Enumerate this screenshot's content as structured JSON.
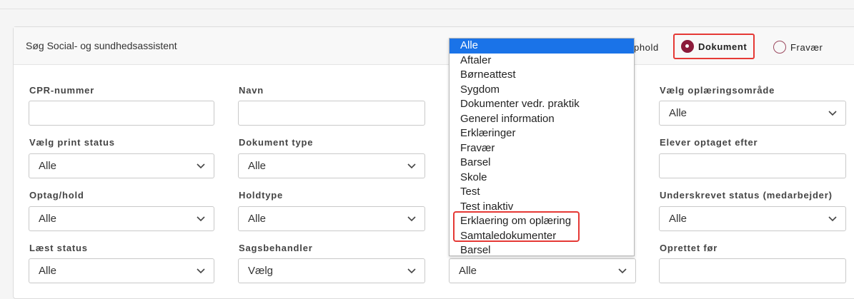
{
  "header": {
    "title": "Søg Social- og sundhedsassistent",
    "radios": [
      {
        "label": "phold",
        "checked": false
      },
      {
        "label": "Dokument",
        "checked": true
      },
      {
        "label": "Fravær",
        "checked": false
      }
    ]
  },
  "fields": {
    "cpr": {
      "label": "CPR-nummer",
      "value": ""
    },
    "navn": {
      "label": "Navn",
      "value": ""
    },
    "oplaeringsomraade": {
      "label": "Vælg oplæringsområde",
      "value": "Alle"
    },
    "printstatus": {
      "label": "Vælg print status",
      "value": "Alle"
    },
    "dokumenttype": {
      "label": "Dokument type",
      "value": "Alle"
    },
    "optaget_efter": {
      "label": "Elever optaget efter",
      "value": ""
    },
    "optag_hold": {
      "label": "Optag/hold",
      "value": "Alle"
    },
    "holdtype": {
      "label": "Holdtype",
      "value": "Alle"
    },
    "underskrevet": {
      "label": "Underskrevet status (medarbejder)",
      "value": "Alle"
    },
    "laest_status": {
      "label": "Læst status",
      "value": "Alle"
    },
    "sagsbehandler": {
      "label": "Sagsbehandler",
      "value": "Vælg"
    },
    "kategori": {
      "value": "Alle"
    },
    "oprettet_foer": {
      "label": "Oprettet før",
      "value": ""
    }
  },
  "dropdown": {
    "options": [
      "Alle",
      "Aftaler",
      "Børneattest",
      "Sygdom",
      "Dokumenter vedr. praktik",
      "Generel information",
      "Erklæringer",
      "Fravær",
      "Barsel",
      "Skole",
      "Test",
      "Test inaktiv",
      "Erklaering om oplæring",
      "Samtaledokumenter",
      "Barsel"
    ],
    "selected_index": 0
  },
  "colors": {
    "accent": "#8b1a3a",
    "highlight": "#e53935",
    "selected_option": "#1a73e8"
  }
}
